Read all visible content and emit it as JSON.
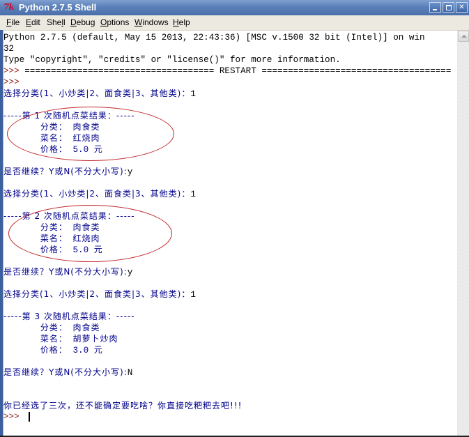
{
  "window": {
    "title": "Python 2.7.5 Shell",
    "app_icon": "tk-icon",
    "controls": [
      "minimize",
      "maximize",
      "close"
    ]
  },
  "menubar": {
    "items": [
      {
        "label": "File",
        "mnemonic": "F"
      },
      {
        "label": "Edit",
        "mnemonic": "E"
      },
      {
        "label": "Shell",
        "mnemonic": "l"
      },
      {
        "label": "Debug",
        "mnemonic": "D"
      },
      {
        "label": "Options",
        "mnemonic": "O"
      },
      {
        "label": "Windows",
        "mnemonic": "W"
      },
      {
        "label": "Help",
        "mnemonic": "H"
      }
    ]
  },
  "shell": {
    "banner_line1": "Python 2.7.5 (default, May 15 2013, 22:43:36) [MSC v.1500 32 bit (Intel)] on win",
    "banner_line2": "32",
    "banner_line3": "Type \"copyright\", \"credits\" or \"license()\" for more information.",
    "restart_line": "==================================== RESTART ====================================",
    "prompt": ">>>",
    "choose_prompt": "选择分类(1、小炒类|2、面食类|3、其他类)：",
    "continue_prompt": "是否继续？Y或N(不分大小写):",
    "label_category": "分类：",
    "label_dish": "菜名：",
    "label_price": "价格：",
    "price_unit": "元",
    "rounds": [
      {
        "choice": "1",
        "header": "-----第 1 次随机点菜结果：-----",
        "category": "肉食类",
        "dish": "红烧肉",
        "price": "5.0",
        "continue_answer": "y",
        "annotated": true
      },
      {
        "choice": "1",
        "header": "-----第 2 次随机点菜结果：-----",
        "category": "肉食类",
        "dish": "红烧肉",
        "price": "5.0",
        "continue_answer": "y",
        "annotated": true
      },
      {
        "choice": "1",
        "header": "-----第 3 次随机点菜结果：-----",
        "category": "肉食类",
        "dish": "胡萝卜炒肉",
        "price": "3.0",
        "continue_answer": "N",
        "annotated": false
      }
    ],
    "final_message": "你已经选了三次，还不能确定要吃啥？你直接吃粑粑去吧!!!"
  },
  "annotation": {
    "color": "#c0262a"
  }
}
